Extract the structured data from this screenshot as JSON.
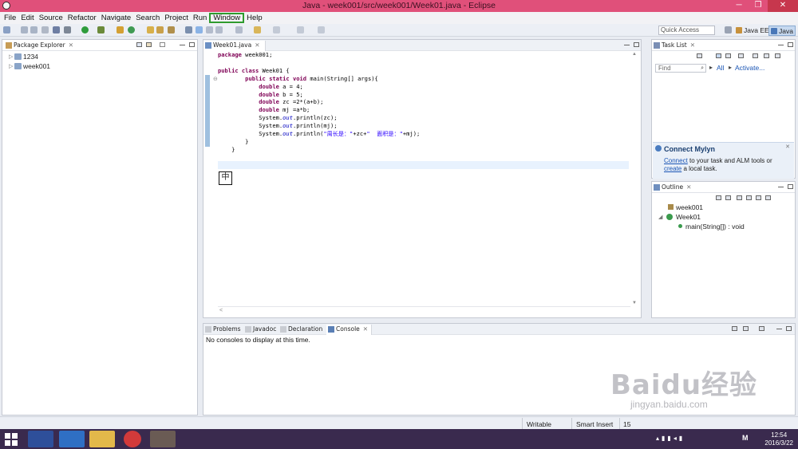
{
  "window": {
    "title": "Java - week001/src/week001/Week01.java - Eclipse",
    "min": "─",
    "max": "❐",
    "close": "✕"
  },
  "menu": [
    "File",
    "Edit",
    "Source",
    "Refactor",
    "Navigate",
    "Search",
    "Project",
    "Run",
    "Window",
    "Help"
  ],
  "highlighted_menu": "Window",
  "toolbar": {
    "quick_access_placeholder": "Quick Access"
  },
  "perspectives": [
    "Java EE",
    "Java"
  ],
  "package_explorer": {
    "tab": "Package Explorer",
    "items": [
      "1234",
      "week001"
    ]
  },
  "editor": {
    "tab": "Week01.java",
    "lines": [
      "package week001;",
      "",
      "public class Week01 {",
      "    public static void main(String[] args){",
      "        double a = 4;",
      "        double b = 5;",
      "        double zc =2*(a+b);",
      "        double mj =a*b;",
      "        System.out.println(zc);",
      "        System.out.println(mj);",
      "        System.out.println(\"周长是：\"+zc+\"  面积是：\"+mj);",
      "    }",
      "}"
    ],
    "ime_indicator": "中"
  },
  "task_list": {
    "tab": "Task List",
    "find_placeholder": "Find",
    "all": "All",
    "activate": "Activate..."
  },
  "mylyn": {
    "title": "Connect Mylyn",
    "connect_link": "Connect",
    "text1": " to your task and ALM tools or ",
    "create_link": "create",
    "text2": " a local task."
  },
  "outline": {
    "tab": "Outline",
    "items": [
      "week001",
      "Week01",
      "main(String[]) : void"
    ]
  },
  "bottom_tabs": [
    "Problems",
    "Javadoc",
    "Declaration",
    "Console"
  ],
  "console": {
    "message": "No consoles to display at this time."
  },
  "status": {
    "writable": "Writable",
    "insert_mode": "Smart Insert",
    "position": "15"
  },
  "taskbar": {
    "time": "12:54",
    "date": "2016/3/22"
  },
  "watermark": {
    "main": "Baidu经验",
    "sub": "jingyan.baidu.com"
  }
}
